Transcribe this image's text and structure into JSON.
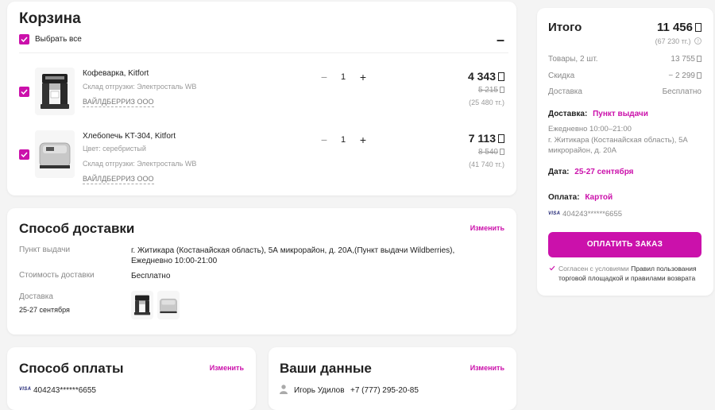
{
  "cart": {
    "title": "Корзина",
    "select_all": "Выбрать все",
    "collapse": "–",
    "items": [
      {
        "name": "Кофеварка, Kitfort",
        "color": "",
        "warehouse": "Склад отгрузки: Электросталь WB",
        "seller": "ВАЙЛДБЕРРИЗ ООО",
        "qty": "1",
        "price": "4 343",
        "old_price": "5 215",
        "price_tg": "(25 480 тг.)"
      },
      {
        "name": "Хлебопечь KT-304, Kitfort",
        "color": "Цвет: серебристый",
        "warehouse": "Склад отгрузки: Электросталь WB",
        "seller": "ВАЙЛДБЕРРИЗ ООО",
        "qty": "1",
        "price": "7 113",
        "old_price": "8 540",
        "price_tg": "(41 740 тг.)"
      }
    ]
  },
  "delivery": {
    "title": "Способ доставки",
    "edit": "Изменить",
    "pickup_label": "Пункт выдачи",
    "pickup_value_1": "г. Житикара (Костанайская область), 5А микрорайон, д. 20А,(Пункт выдачи Wildberries),",
    "pickup_value_2": "Ежедневно 10:00-21:00",
    "cost_label": "Стоимость доставки",
    "cost_value": "Бесплатно",
    "date_label": "Доставка",
    "date_value": "25-27 сентября"
  },
  "payment": {
    "title": "Способ оплаты",
    "edit": "Изменить",
    "card_brand": "VISA",
    "card_number": "404243******6655"
  },
  "mydata": {
    "title": "Ваши данные",
    "edit": "Изменить",
    "name": "Игорь Удилов",
    "phone": "+7 (777) 295-20-85"
  },
  "summary": {
    "title": "Итого",
    "total": "11 456",
    "total_tg": "(67 230 тг.)",
    "goods_label": "Товары, 2 шт.",
    "goods_value": "13 755",
    "discount_label": "Скидка",
    "discount_value": "− 2 299",
    "delivery_label": "Доставка",
    "delivery_value": "Бесплатно",
    "delivery_method_label": "Доставка:",
    "delivery_method_value": "Пункт выдачи",
    "schedule": "Ежедневно 10:00–21:00",
    "address": "г. Житикара (Костанайская область), 5А микрорайон, д. 20А",
    "date_label": "Дата:",
    "date_value": "25-27 сентября",
    "payment_label": "Оплата:",
    "payment_value": "Картой",
    "card_brand": "VISA",
    "card_number": "404243******6655",
    "pay_button": "ОПЛАТИТЬ ЗАКАЗ",
    "agree_text": "Согласен с условиями",
    "agree_link_1": "Правил пользования",
    "agree_link_2": "торговой площадкой и правилами возврата"
  },
  "colors": {
    "accent": "#cb11ab",
    "background": "#f4f4f4"
  },
  "icons": [
    "checkbox-checked-icon",
    "currency-icon",
    "info-icon",
    "check-icon",
    "user-icon"
  ]
}
